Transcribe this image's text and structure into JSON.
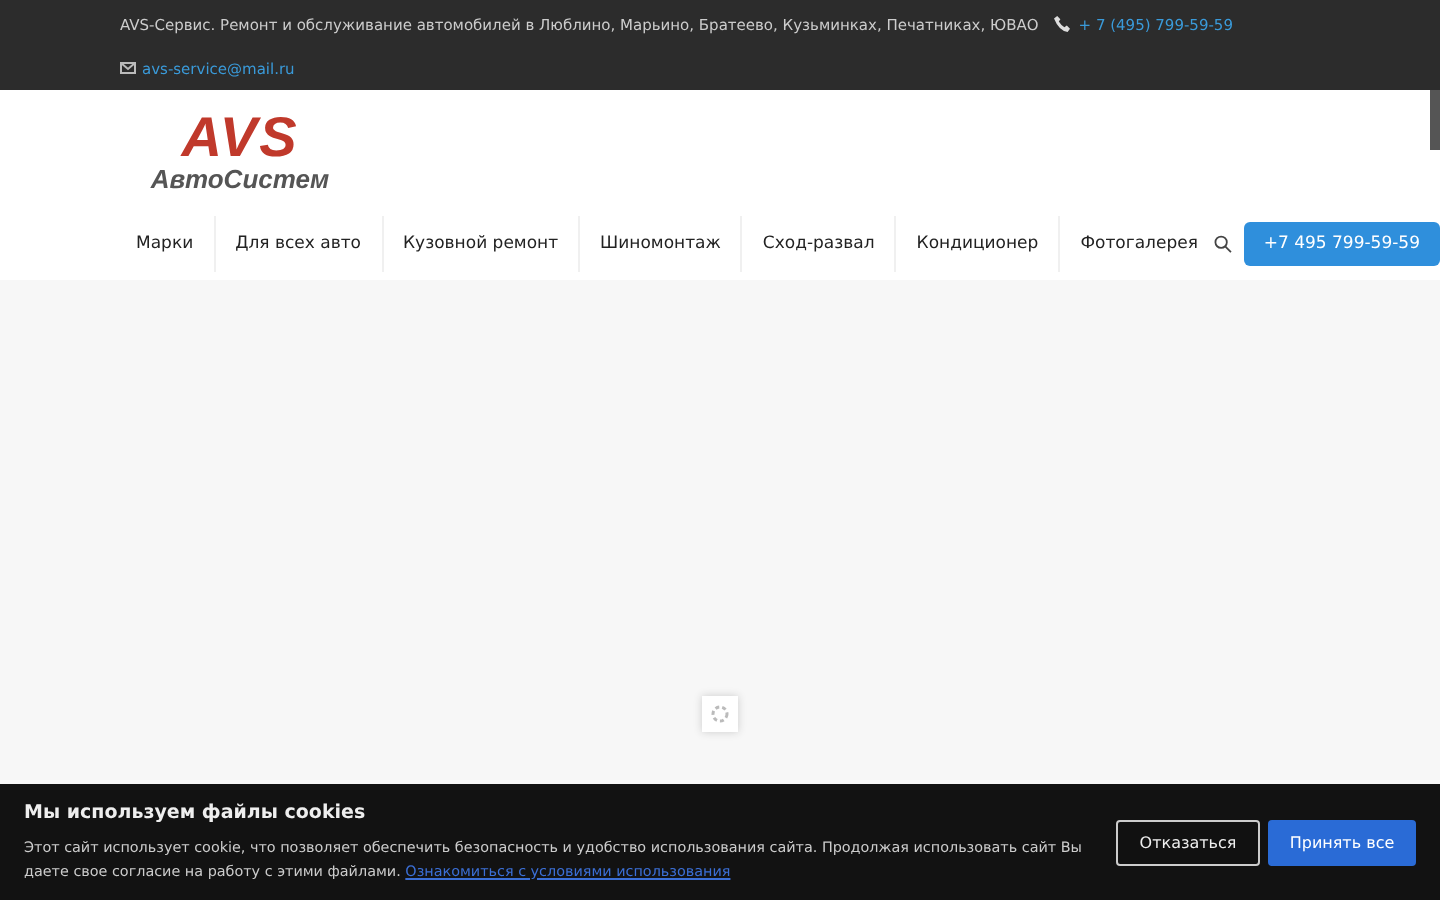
{
  "topbar": {
    "text": "AVS-Сервис. Ремонт и обслуживание автомобилей в Люблино, Марьино, Братеево, Кузьминках, Печатниках, ЮВАО",
    "phone": "+ 7 (495) 799-59-59",
    "email": "avs-service@mail.ru"
  },
  "logo": {
    "title": "AVS",
    "subtitle": "АвтоСистем"
  },
  "nav": [
    "Марки",
    "Для всех авто",
    "Кузовной ремонт",
    "Шиномонтаж",
    "Сход-развал",
    "Кондиционер",
    "Фотогалерея"
  ],
  "call_button": "+7 495 799-59-59",
  "cookie": {
    "title": "Мы используем файлы cookies",
    "text": "Этот сайт использует cookie, что позволяет обеспечить безопасность и удобство использования сайта. Продолжая использовать сайт Вы даете свое согласие на работу с этими файлами.",
    "link": "Ознакомиться с условиями использования",
    "decline": "Отказаться",
    "accept": "Принять все"
  }
}
